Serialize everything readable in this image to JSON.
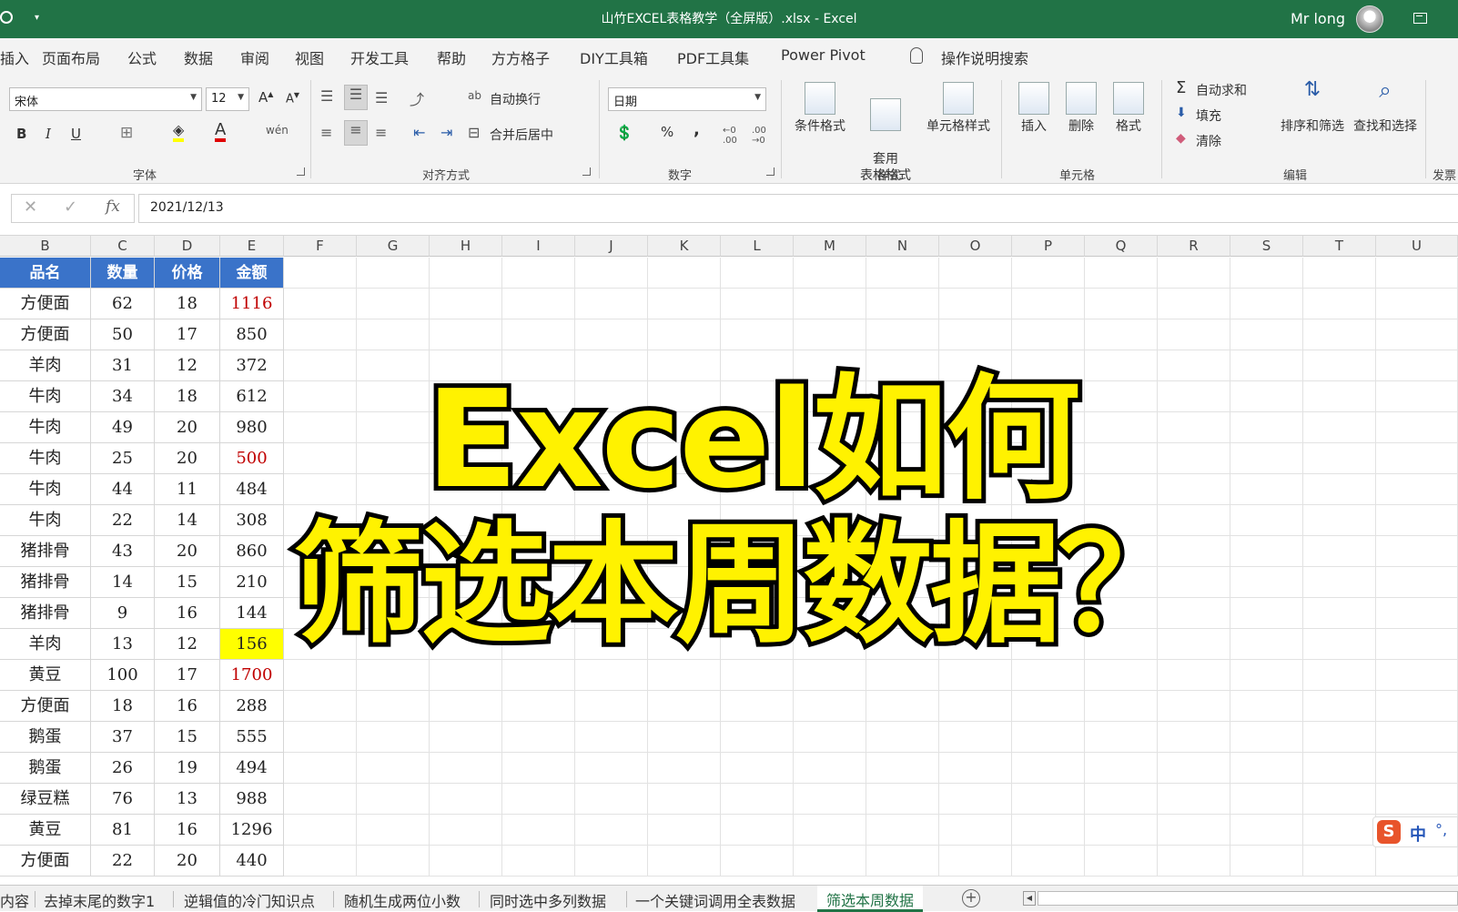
{
  "window": {
    "title": "山竹EXCEL表格教学（全屏版）.xlsx  -  Excel",
    "user": "Mr long"
  },
  "ribbon_tabs": [
    "插入",
    "页面布局",
    "公式",
    "数据",
    "审阅",
    "视图",
    "开发工具",
    "帮助",
    "方方格子",
    "DIY工具箱",
    "PDF工具集",
    "Power Pivot"
  ],
  "tell_me": "操作说明搜索",
  "ribbon": {
    "font_name": "宋体",
    "font_size": "12",
    "bold": "B",
    "italic": "I",
    "underline": "U",
    "wrap_text": "自动换行",
    "merge_center": "合并后居中",
    "number_format": "日期",
    "percent": "%",
    "comma": ",",
    "conditional_format": "条件格式",
    "table_format": "套用\n表格格式",
    "cell_styles": "单元格样式",
    "insert": "插入",
    "delete": "删除",
    "format": "格式",
    "autosum": "自动求和",
    "fill": "填充",
    "clear": "清除",
    "sort_filter": "排序和筛选",
    "find_select": "查找和选择",
    "group_font": "字体",
    "group_align": "对齐方式",
    "group_number": "数字",
    "group_styles": "样式",
    "group_cells": "单元格",
    "group_edit": "编辑",
    "group_cut": "发票"
  },
  "formula_bar": {
    "value": "2021/12/13",
    "fx": "fx"
  },
  "columns": [
    "B",
    "C",
    "D",
    "E",
    "F",
    "G",
    "H",
    "I",
    "J",
    "K",
    "L",
    "M",
    "N",
    "O",
    "P",
    "Q",
    "R",
    "S",
    "T",
    "U"
  ],
  "table": {
    "headers": [
      "品名",
      "数量",
      "价格",
      "金额"
    ],
    "rows": [
      {
        "name": "方便面",
        "qty": "62",
        "price": "18",
        "amount": "1116",
        "style": "red"
      },
      {
        "name": "方便面",
        "qty": "50",
        "price": "17",
        "amount": "850",
        "style": ""
      },
      {
        "name": "羊肉",
        "qty": "31",
        "price": "12",
        "amount": "372",
        "style": ""
      },
      {
        "name": "牛肉",
        "qty": "34",
        "price": "18",
        "amount": "612",
        "style": ""
      },
      {
        "name": "牛肉",
        "qty": "49",
        "price": "20",
        "amount": "980",
        "style": ""
      },
      {
        "name": "牛肉",
        "qty": "25",
        "price": "20",
        "amount": "500",
        "style": "red"
      },
      {
        "name": "牛肉",
        "qty": "44",
        "price": "11",
        "amount": "484",
        "style": ""
      },
      {
        "name": "牛肉",
        "qty": "22",
        "price": "14",
        "amount": "308",
        "style": ""
      },
      {
        "name": "猪排骨",
        "qty": "43",
        "price": "20",
        "amount": "860",
        "style": ""
      },
      {
        "name": "猪排骨",
        "qty": "14",
        "price": "15",
        "amount": "210",
        "style": ""
      },
      {
        "name": "猪排骨",
        "qty": "9",
        "price": "16",
        "amount": "144",
        "style": ""
      },
      {
        "name": "羊肉",
        "qty": "13",
        "price": "12",
        "amount": "156",
        "style": "yellow"
      },
      {
        "name": "黄豆",
        "qty": "100",
        "price": "17",
        "amount": "1700",
        "style": "red"
      },
      {
        "name": "方便面",
        "qty": "18",
        "price": "16",
        "amount": "288",
        "style": ""
      },
      {
        "name": "鹅蛋",
        "qty": "37",
        "price": "15",
        "amount": "555",
        "style": ""
      },
      {
        "name": "鹅蛋",
        "qty": "26",
        "price": "19",
        "amount": "494",
        "style": ""
      },
      {
        "name": "绿豆糕",
        "qty": "76",
        "price": "13",
        "amount": "988",
        "style": ""
      },
      {
        "name": "黄豆",
        "qty": "81",
        "price": "16",
        "amount": "1296",
        "style": ""
      },
      {
        "name": "方便面",
        "qty": "22",
        "price": "20",
        "amount": "440",
        "style": ""
      }
    ]
  },
  "overlay_title": {
    "line1": "Excel如何",
    "line2": "筛选本周数据？"
  },
  "ime": {
    "logo": "S",
    "mode": "中",
    "punct": "°,"
  },
  "sheet_tabs": [
    "内容",
    "去掉末尾的数字1",
    "逆辑值的冷门知识点",
    "随机生成两位小数",
    "同时选中多列数据",
    "一个关键词调用全表数据",
    "筛选本周数据"
  ],
  "active_sheet": "筛选本周数据",
  "colors": {
    "excel_green": "#217346",
    "header_blue": "#3a73c9",
    "title_yellow": "#fff200",
    "red_value": "#c00000",
    "highlight": "#ffff00"
  }
}
